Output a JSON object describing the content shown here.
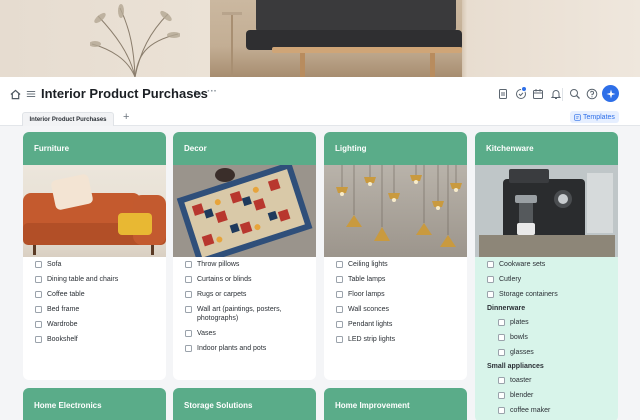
{
  "header": {
    "title": "Interior Product Purchases"
  },
  "tabs": {
    "active_label": "Interior Product Purchases",
    "add_label": "+"
  },
  "toolbar": {
    "templates_label": "Templates"
  },
  "columns": [
    {
      "title": "Furniture",
      "items": [
        "Sofa",
        "Dining table and chairs",
        "Coffee table",
        "Bed frame",
        "Wardrobe",
        "Bookshelf"
      ]
    },
    {
      "title": "Decor",
      "items": [
        "Throw pillows",
        "Curtains or blinds",
        "Rugs or carpets",
        "Wall art (paintings, posters, photographs)",
        "Vases",
        "Indoor plants and pots"
      ]
    },
    {
      "title": "Lighting",
      "items": [
        "Ceiling lights",
        "Table lamps",
        "Floor lamps",
        "Wall sconces",
        "Pendant lights",
        "LED strip lights"
      ]
    },
    {
      "title": "Kitchenware",
      "items": [
        "Cookware sets",
        "Cutlery",
        "Storage containers"
      ],
      "groups": [
        {
          "heading": "Dinnerware",
          "items": [
            "plates",
            "bowls",
            "glasses"
          ]
        },
        {
          "heading": "Small appliances",
          "items": [
            "toaster",
            "blender",
            "coffee maker"
          ]
        }
      ]
    }
  ],
  "bottom_columns": [
    "Home Electronics",
    "Storage Solutions",
    "Home Improvement"
  ],
  "colors": {
    "column_header": "#5aac89",
    "kitchen_body": "#d8f4ea",
    "accent": "#2e6fe8"
  },
  "icons": [
    "home-icon",
    "menu-icon",
    "undo-icon",
    "more-icon",
    "document-icon",
    "check-badge-icon",
    "calendar-icon",
    "bell-icon",
    "search-icon",
    "help-icon",
    "sparkle-icon",
    "template-icon"
  ]
}
